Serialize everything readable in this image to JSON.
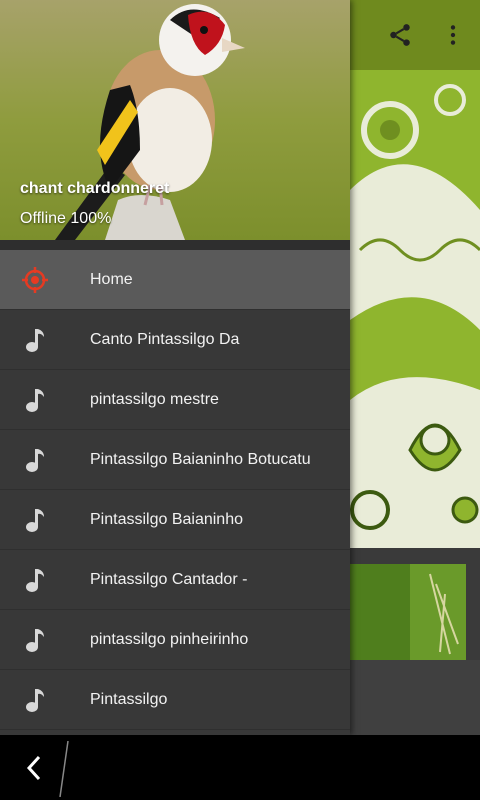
{
  "header": {
    "title": "chant chardonneret",
    "subtitle": "Offline 100%"
  },
  "menu": {
    "items": [
      {
        "label": "Home",
        "icon": "target-icon",
        "active": true
      },
      {
        "label": "Canto Pintassilgo Da",
        "icon": "music-note-icon"
      },
      {
        "label": "pintassilgo mestre",
        "icon": "music-note-icon"
      },
      {
        "label": "Pintassilgo Baianinho Botucatu",
        "icon": "music-note-icon"
      },
      {
        "label": "Pintassilgo Baianinho",
        "icon": "music-note-icon"
      },
      {
        "label": "Pintassilgo Cantador -",
        "icon": "music-note-icon"
      },
      {
        "label": "pintassilgo pinheirinho",
        "icon": "music-note-icon"
      },
      {
        "label": "Pintassilgo",
        "icon": "music-note-icon"
      }
    ]
  },
  "toolbar": {
    "share_icon": "share-icon",
    "more_icon": "more-vertical-icon"
  },
  "colors": {
    "accent": "#6f8a1e",
    "active_icon": "#e53a22",
    "drawer_bg": "#383838"
  }
}
